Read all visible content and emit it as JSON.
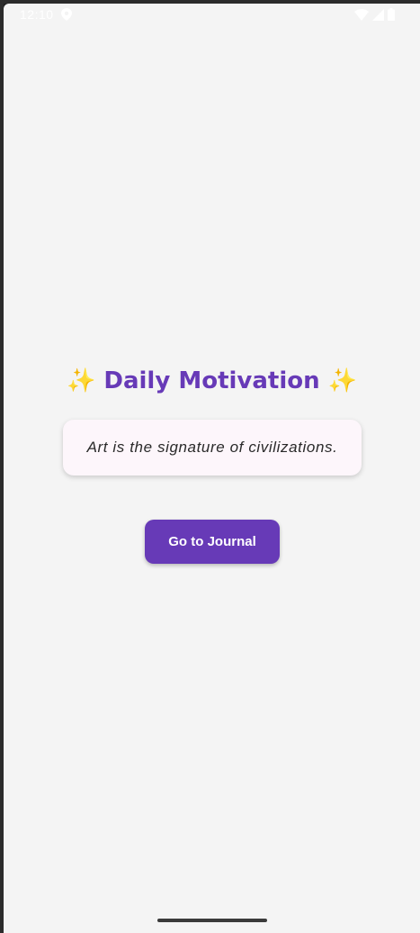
{
  "status_bar": {
    "time": "12:10",
    "icons": [
      "location-icon",
      "wifi-icon",
      "signal-icon",
      "battery-icon"
    ]
  },
  "screen": {
    "title": "✨ Daily Motivation ✨",
    "quote": "Art is the signature of civilizations.",
    "button_label": "Go to Journal"
  },
  "colors": {
    "accent": "#673ab7",
    "background": "#f4f4f4",
    "card": "#fdf6fb"
  }
}
